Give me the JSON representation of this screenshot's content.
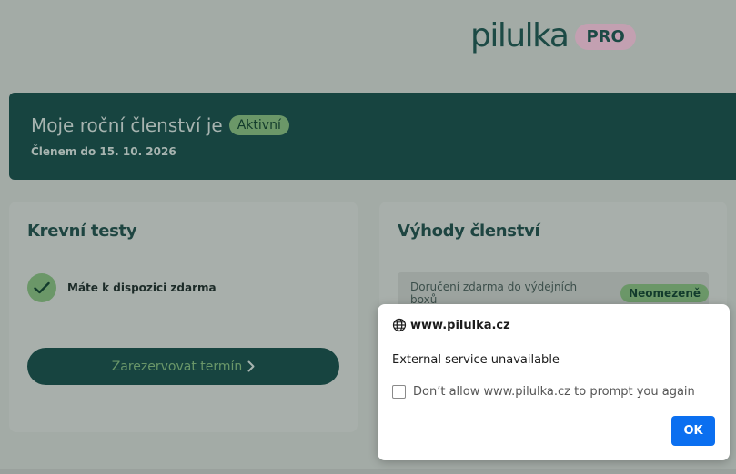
{
  "logo": {
    "wordmark": "pilulka",
    "badge": "PRO"
  },
  "membership": {
    "title": "Moje roční členství je",
    "status": "Aktivní",
    "member_until": "Členem do 15. 10. 2026"
  },
  "blood_tests": {
    "title": "Krevní testy",
    "available_label": "Máte k dispozici zdarma",
    "reserve_button": "Zarezervovat termín"
  },
  "benefits": {
    "title": "Výhody členství",
    "items": [
      {
        "label": "Doručení zdarma do výdejních boxů",
        "value": "Neomezeně"
      }
    ]
  },
  "dialog": {
    "origin": "www.pilulka.cz",
    "message": "External service unavailable",
    "checkbox_label": "Don’t allow www.pilulka.cz to prompt you again",
    "ok_label": "OK"
  },
  "colors": {
    "brand_dark": "#174440",
    "accent_green": "#6b9768",
    "pro_pink": "#c3a0b1",
    "dialog_ok": "#0b6ff0"
  }
}
